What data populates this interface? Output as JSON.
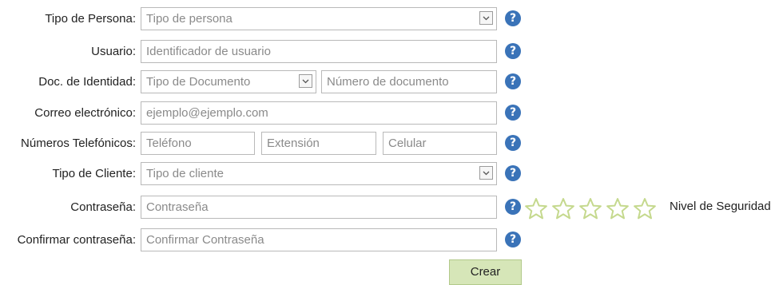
{
  "form": {
    "tipo_persona": {
      "label": "Tipo de Persona:",
      "placeholder": "Tipo de persona"
    },
    "usuario": {
      "label": "Usuario:",
      "placeholder": "Identificador de usuario"
    },
    "doc_identidad": {
      "label": "Doc. de Identidad:",
      "tipo_placeholder": "Tipo de Documento",
      "numero_placeholder": "Número de documento"
    },
    "correo": {
      "label": "Correo electrónico:",
      "placeholder": "ejemplo@ejemplo.com"
    },
    "telefonos": {
      "label": "Números Telefónicos:",
      "telefono_placeholder": "Teléfono",
      "extension_placeholder": "Extensión",
      "celular_placeholder": "Celular"
    },
    "tipo_cliente": {
      "label": "Tipo de Cliente:",
      "placeholder": "Tipo de cliente"
    },
    "contrasena": {
      "label": "Contraseña:",
      "placeholder": "Contraseña"
    },
    "confirmar": {
      "label": "Confirmar contraseña:",
      "placeholder": "Confirmar Contraseña"
    },
    "help_glyph": "?",
    "security": {
      "label": "Nivel de Seguridad",
      "stars_total": 5,
      "stars_filled": 0,
      "star_color": "#c5d98e"
    },
    "submit_label": "Crear"
  },
  "colors": {
    "help_icon": "#3a73b8",
    "button_bg": "#d6e6b8",
    "field_border": "#b9b9b9"
  }
}
